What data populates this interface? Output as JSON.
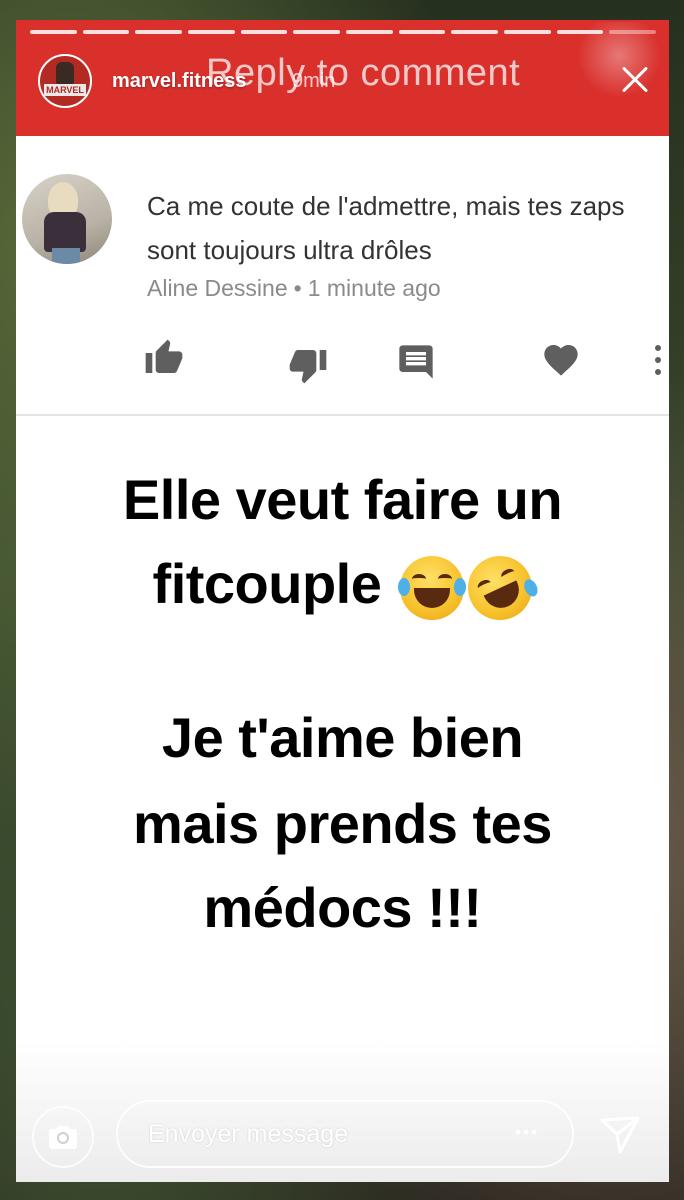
{
  "story": {
    "username": "marvel.fitness",
    "time": "9min",
    "avatar_text": "MARVEL",
    "progress_segments": 12,
    "active_segments": 11
  },
  "sticker": {
    "title": "Reply to comment",
    "comment_text": "Ca me coute de l'admettre, mais tes zaps sont toujours ultra drôles",
    "comment_author": "Aline Dessine",
    "comment_separator": "•",
    "comment_time": "1 minute ago"
  },
  "caption": {
    "line1": "Elle veut faire un",
    "line2": "fitcouple",
    "line3": "Je t'aime bien",
    "line4": "mais prends tes",
    "line5": "médocs !!!"
  },
  "footer": {
    "message_placeholder": "Envoyer message"
  },
  "colors": {
    "header_red": "#d9302c",
    "card_white": "#ffffff",
    "icon_gray": "#5f5f5f"
  }
}
